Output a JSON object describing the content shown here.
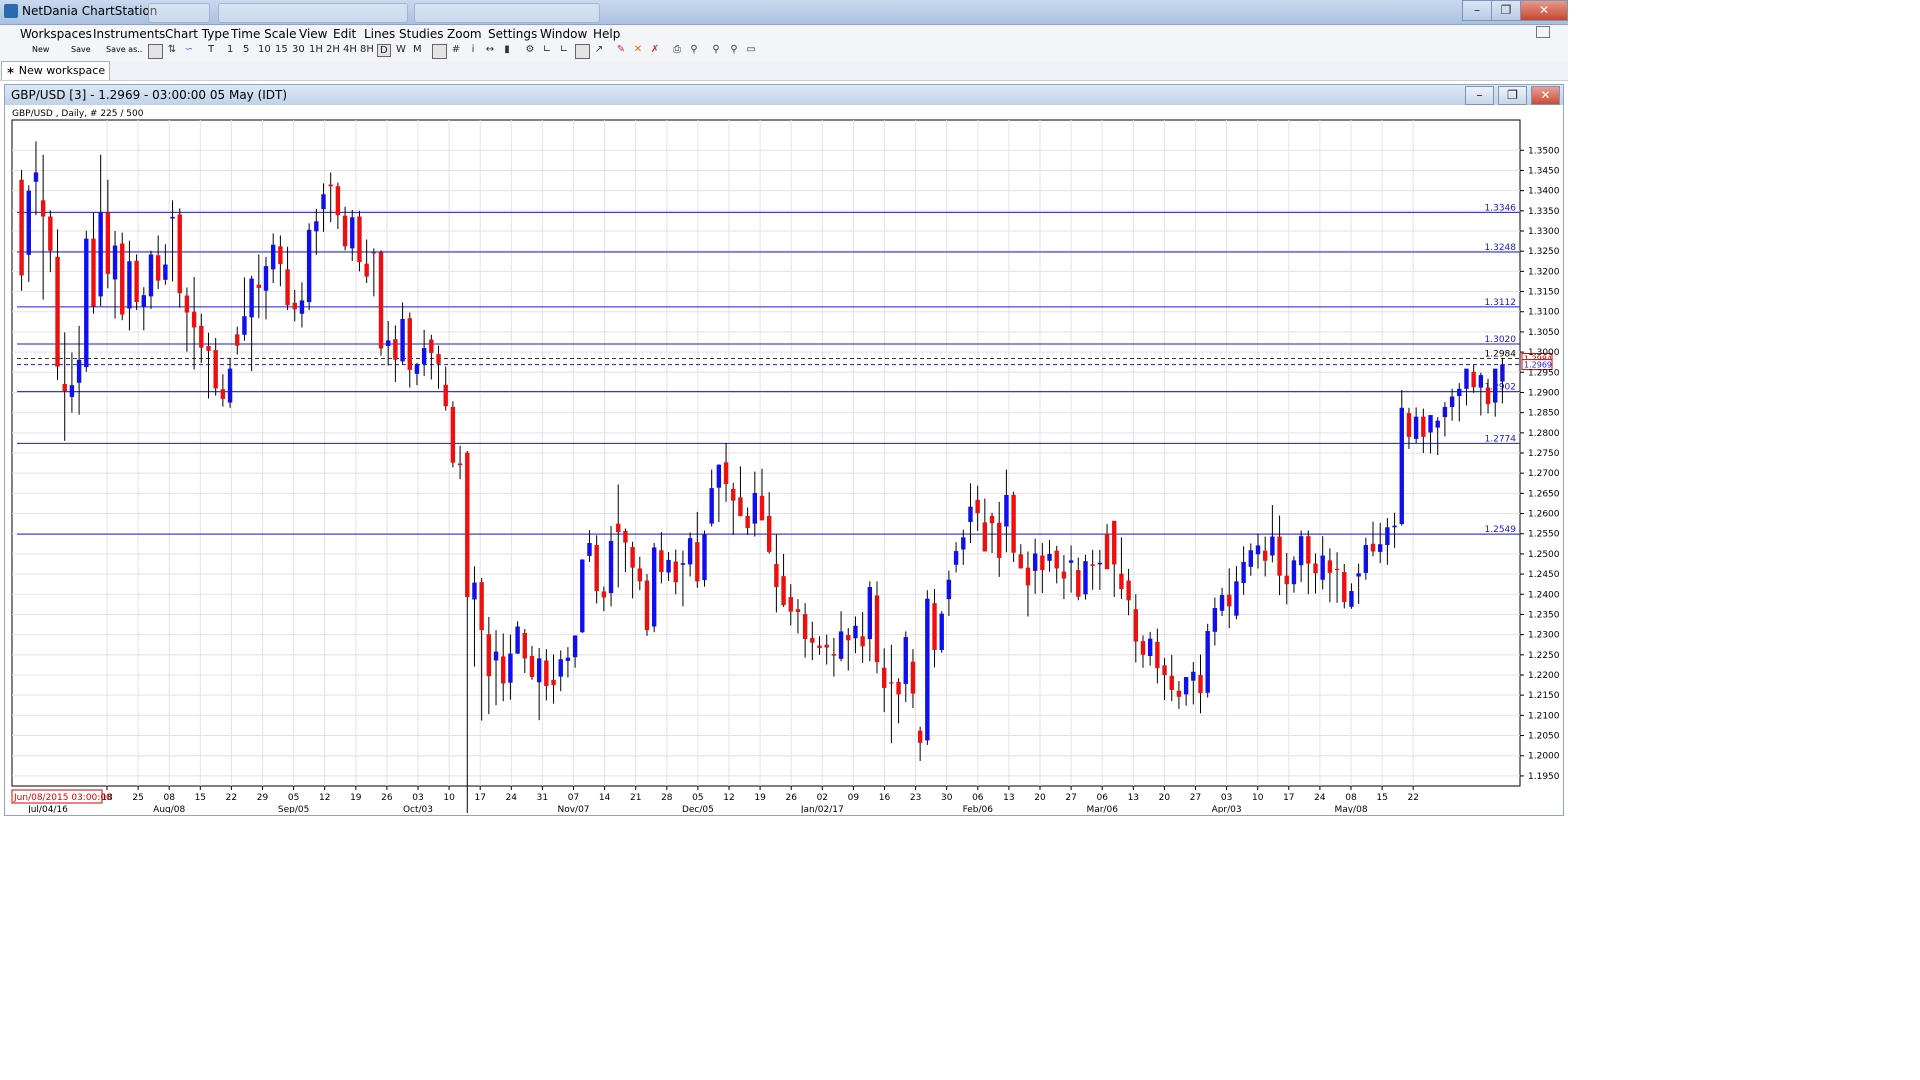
{
  "app": {
    "title": "NetDania ChartStation"
  },
  "menu": [
    "Workspaces",
    "Instruments",
    "Chart Type",
    "Time Scale",
    "View",
    "Edit",
    "Lines",
    "Studies",
    "Zoom",
    "Settings",
    "Window",
    "Help"
  ],
  "toolbar": {
    "new_label": "New",
    "save_label": "Save",
    "saveas_label": "Save as..",
    "timescales": [
      "T",
      "1",
      "5",
      "10",
      "15",
      "30",
      "1H",
      "2H",
      "4H",
      "8H",
      "D",
      "W",
      "M"
    ],
    "selected_timescale": "D"
  },
  "workspace_tab": "New workspace",
  "chart_window": {
    "title": "GBP/USD [3] - 1.2969 - 03:00:00  05 May (IDT)"
  },
  "chart_data": {
    "type": "candlestick",
    "instrument_label": "GBP/USD , Daily, # 225 / 500",
    "ylim": [
      1.1925,
      1.3575
    ],
    "y_ticks": [
      "1.3500",
      "1.3450",
      "1.3400",
      "1.3350",
      "1.3300",
      "1.3250",
      "1.3200",
      "1.3150",
      "1.3100",
      "1.3050",
      "1.3000",
      "1.2950",
      "1.2900",
      "1.2850",
      "1.2800",
      "1.2750",
      "1.2700",
      "1.2650",
      "1.2600",
      "1.2550",
      "1.2500",
      "1.2450",
      "1.2400",
      "1.2350",
      "1.2300",
      "1.2250",
      "1.2200",
      "1.2150",
      "1.2100",
      "1.2050",
      "1.2000",
      "1.1950"
    ],
    "horizontal_lines": [
      {
        "value": 1.3346,
        "label": "1.3346"
      },
      {
        "value": 1.3248,
        "label": "1.3248"
      },
      {
        "value": 1.3112,
        "label": "1.3112"
      },
      {
        "value": 1.302,
        "label": "1.3020"
      },
      {
        "value": 1.2902,
        "label": "1.2902"
      },
      {
        "value": 1.2774,
        "label": "1.2774"
      },
      {
        "value": 1.2549,
        "label": "1.2549"
      }
    ],
    "dashed_lines": [
      {
        "value": 1.2984,
        "label": "1.2984"
      },
      {
        "value": 1.2969,
        "label": "1.2969"
      }
    ],
    "first_date_label": "Jun/08/2015 03:00:00",
    "x_day_labels": [
      "18",
      "25",
      "08",
      "15",
      "22",
      "29",
      "05",
      "12",
      "19",
      "26",
      "03",
      "10",
      "17",
      "24",
      "31",
      "07",
      "14",
      "21",
      "28",
      "05",
      "12",
      "19",
      "26",
      "02",
      "09",
      "16",
      "23",
      "30",
      "06",
      "13",
      "20",
      "27",
      "06",
      "13",
      "20",
      "27",
      "03",
      "10",
      "17",
      "24",
      "08",
      "15",
      "22"
    ],
    "x_month_labels": [
      "Jul/04/16",
      "Aug/08",
      "Sep/05",
      "Oct/03",
      "Nov/07",
      "Dec/05",
      "Jan/02/17",
      "Feb/06",
      "Mar/06",
      "Apr/03",
      "May/08"
    ],
    "candles": [
      [
        1.3427,
        1.3451,
        1.3152,
        1.319
      ],
      [
        1.3241,
        1.3413,
        1.3174,
        1.34
      ],
      [
        1.3422,
        1.3522,
        1.3339,
        1.3445
      ],
      [
        1.3376,
        1.3489,
        1.313,
        1.3336
      ],
      [
        1.3336,
        1.3351,
        1.3198,
        1.3251
      ],
      [
        1.3236,
        1.3304,
        1.2931,
        1.2964
      ],
      [
        1.2921,
        1.3049,
        1.278,
        1.2903
      ],
      [
        1.2889,
        1.2999,
        1.285,
        1.2918
      ],
      [
        1.2924,
        1.3065,
        1.2845,
        1.2981
      ],
      [
        1.2963,
        1.3301,
        1.2951,
        1.3281
      ],
      [
        1.3281,
        1.3345,
        1.3095,
        1.3113
      ],
      [
        1.3138,
        1.3489,
        1.3114,
        1.3346
      ],
      [
        1.3346,
        1.3427,
        1.3158,
        1.3194
      ],
      [
        1.318,
        1.33,
        1.3083,
        1.3264
      ],
      [
        1.3269,
        1.3296,
        1.3079,
        1.3093
      ],
      [
        1.3108,
        1.3276,
        1.3054,
        1.3225
      ],
      [
        1.3226,
        1.3242,
        1.3104,
        1.3124
      ],
      [
        1.3112,
        1.3161,
        1.3054,
        1.3141
      ],
      [
        1.3138,
        1.3251,
        1.3107,
        1.3242
      ],
      [
        1.324,
        1.3289,
        1.3156,
        1.3177
      ],
      [
        1.3179,
        1.3267,
        1.3167,
        1.3217
      ],
      [
        1.3331,
        1.3376,
        1.3175,
        1.3335
      ],
      [
        1.3341,
        1.3356,
        1.311,
        1.3146
      ],
      [
        1.314,
        1.316,
        1.3001,
        1.3098
      ],
      [
        1.31,
        1.3186,
        1.2957,
        1.3061
      ],
      [
        1.3065,
        1.3095,
        1.2973,
        1.3011
      ],
      [
        1.3015,
        1.3048,
        1.2885,
        1.3003
      ],
      [
        1.3005,
        1.3035,
        1.2892,
        1.291
      ],
      [
        1.2908,
        1.2945,
        1.2865,
        1.2884
      ],
      [
        1.2875,
        1.2986,
        1.2862,
        1.2959
      ],
      [
        1.3044,
        1.3063,
        1.2994,
        1.3016
      ],
      [
        1.3043,
        1.3185,
        1.3028,
        1.3089
      ],
      [
        1.3086,
        1.3189,
        1.2953,
        1.3182
      ],
      [
        1.3167,
        1.3242,
        1.3084,
        1.3159
      ],
      [
        1.3152,
        1.3236,
        1.3081,
        1.3213
      ],
      [
        1.3205,
        1.3294,
        1.3171,
        1.3266
      ],
      [
        1.3262,
        1.3289,
        1.3163,
        1.3218
      ],
      [
        1.3205,
        1.3261,
        1.3104,
        1.3116
      ],
      [
        1.3122,
        1.3154,
        1.3076,
        1.3106
      ],
      [
        1.3095,
        1.3173,
        1.3061,
        1.3128
      ],
      [
        1.3124,
        1.3319,
        1.3104,
        1.3303
      ],
      [
        1.3299,
        1.3355,
        1.3241,
        1.3324
      ],
      [
        1.3354,
        1.3418,
        1.3298,
        1.3391
      ],
      [
        1.3415,
        1.3445,
        1.3322,
        1.3411
      ],
      [
        1.3411,
        1.342,
        1.3305,
        1.3339
      ],
      [
        1.3338,
        1.336,
        1.3252,
        1.3262
      ],
      [
        1.3257,
        1.3352,
        1.3226,
        1.3334
      ],
      [
        1.3336,
        1.335,
        1.32,
        1.3223
      ],
      [
        1.3219,
        1.3279,
        1.3171,
        1.3187
      ],
      [
        1.3247,
        1.3257,
        1.3138,
        1.3246
      ],
      [
        1.3247,
        1.3252,
        1.2991,
        1.3009
      ],
      [
        1.3015,
        1.3077,
        1.2967,
        1.3029
      ],
      [
        1.3032,
        1.3066,
        1.2926,
        1.2981
      ],
      [
        1.2977,
        1.3123,
        1.2969,
        1.3082
      ],
      [
        1.3084,
        1.3098,
        1.2912,
        1.2956
      ],
      [
        1.2946,
        1.2973,
        1.2918,
        1.297
      ],
      [
        1.297,
        1.3055,
        1.2941,
        1.301
      ],
      [
        1.3031,
        1.3043,
        1.2932,
        1.2998
      ],
      [
        1.2995,
        1.3016,
        1.2909,
        1.2971
      ],
      [
        1.2919,
        1.2964,
        1.2855,
        1.2866
      ],
      [
        1.2864,
        1.2878,
        1.2714,
        1.2726
      ],
      [
        1.2724,
        1.2768,
        1.2685,
        1.272
      ],
      [
        1.2751,
        1.2755,
        1.1491,
        1.2393
      ],
      [
        1.2387,
        1.2469,
        1.2221,
        1.2429
      ],
      [
        1.243,
        1.244,
        1.2087,
        1.2311
      ],
      [
        1.2301,
        1.2344,
        1.2103,
        1.2197
      ],
      [
        1.2236,
        1.2311,
        1.2125,
        1.2258
      ],
      [
        1.2246,
        1.2303,
        1.2135,
        1.2179
      ],
      [
        1.2181,
        1.23,
        1.2139,
        1.2253
      ],
      [
        1.2253,
        1.2333,
        1.2252,
        1.232
      ],
      [
        1.2304,
        1.2314,
        1.2205,
        1.2241
      ],
      [
        1.2247,
        1.2272,
        1.2188,
        1.2195
      ],
      [
        1.2182,
        1.2267,
        1.2088,
        1.2241
      ],
      [
        1.2236,
        1.2264,
        1.2137,
        1.2173
      ],
      [
        1.2188,
        1.2251,
        1.2129,
        1.2175
      ],
      [
        1.2196,
        1.2261,
        1.216,
        1.2239
      ],
      [
        1.2235,
        1.2269,
        1.2194,
        1.2243
      ],
      [
        1.2244,
        1.2294,
        1.2218,
        1.2298
      ],
      [
        1.2306,
        1.2487,
        1.2304,
        1.2486
      ],
      [
        1.2495,
        1.2559,
        1.248,
        1.2527
      ],
      [
        1.2522,
        1.2546,
        1.2377,
        1.2408
      ],
      [
        1.2407,
        1.2419,
        1.2358,
        1.2392
      ],
      [
        1.2403,
        1.2569,
        1.237,
        1.2532
      ],
      [
        1.2575,
        1.2672,
        1.2417,
        1.2554
      ],
      [
        1.2557,
        1.2563,
        1.2455,
        1.2528
      ],
      [
        1.2517,
        1.253,
        1.239,
        1.2466
      ],
      [
        1.2464,
        1.2493,
        1.241,
        1.2432
      ],
      [
        1.2434,
        1.245,
        1.2297,
        1.2311
      ],
      [
        1.232,
        1.2527,
        1.2306,
        1.2516
      ],
      [
        1.2509,
        1.2554,
        1.2427,
        1.2455
      ],
      [
        1.2454,
        1.2505,
        1.2433,
        1.2485
      ],
      [
        1.2481,
        1.2511,
        1.24,
        1.243
      ],
      [
        1.2473,
        1.2508,
        1.237,
        1.2477
      ],
      [
        1.2474,
        1.2553,
        1.2444,
        1.2539
      ],
      [
        1.2529,
        1.2604,
        1.2416,
        1.2432
      ],
      [
        1.2435,
        1.2558,
        1.2419,
        1.2548
      ],
      [
        1.2575,
        1.2709,
        1.2568,
        1.2663
      ],
      [
        1.2664,
        1.2722,
        1.2579,
        1.2721
      ],
      [
        1.2727,
        1.2775,
        1.2629,
        1.2673
      ],
      [
        1.2661,
        1.2676,
        1.2547,
        1.2632
      ],
      [
        1.264,
        1.2717,
        1.2593,
        1.2594
      ],
      [
        1.2594,
        1.2615,
        1.2547,
        1.2564
      ],
      [
        1.2575,
        1.2704,
        1.2543,
        1.2651
      ],
      [
        1.2644,
        1.2711,
        1.2584,
        1.2583
      ],
      [
        1.2594,
        1.2653,
        1.2501,
        1.2505
      ],
      [
        1.2475,
        1.2548,
        1.2355,
        1.2418
      ],
      [
        1.2445,
        1.25,
        1.2369,
        1.2373
      ],
      [
        1.2393,
        1.2425,
        1.2323,
        1.2357
      ],
      [
        1.2363,
        1.2388,
        1.2303,
        1.2356
      ],
      [
        1.2351,
        1.2378,
        1.2243,
        1.2289
      ],
      [
        1.2292,
        1.2332,
        1.2237,
        1.228
      ],
      [
        1.2273,
        1.2296,
        1.225,
        1.2267
      ],
      [
        1.2275,
        1.23,
        1.2226,
        1.2268
      ],
      [
        1.2252,
        1.2292,
        1.2196,
        1.2248
      ],
      [
        1.224,
        1.2358,
        1.2234,
        1.2308
      ],
      [
        1.2299,
        1.2316,
        1.2211,
        1.2286
      ],
      [
        1.2291,
        1.2345,
        1.2254,
        1.2322
      ],
      [
        1.2296,
        1.2356,
        1.223,
        1.2271
      ],
      [
        1.2289,
        1.2432,
        1.2234,
        1.2418
      ],
      [
        1.2397,
        1.2432,
        1.2204,
        1.2232
      ],
      [
        1.2218,
        1.2266,
        1.2108,
        1.2168
      ],
      [
        1.2182,
        1.2275,
        1.2031,
        1.2179
      ],
      [
        1.2183,
        1.2192,
        1.208,
        1.2152
      ],
      [
        1.2178,
        1.2308,
        1.2133,
        1.2294
      ],
      [
        1.2233,
        1.2264,
        1.2118,
        1.2154
      ],
      [
        1.2062,
        1.2072,
        1.1987,
        1.2032
      ],
      [
        1.2038,
        1.241,
        1.2027,
        1.2389
      ],
      [
        1.2378,
        1.2413,
        1.2219,
        1.2262
      ],
      [
        1.2262,
        1.2358,
        1.2255,
        1.2352
      ],
      [
        1.2388,
        1.2459,
        1.2346,
        1.2436
      ],
      [
        1.2473,
        1.2529,
        1.2454,
        1.2507
      ],
      [
        1.2511,
        1.256,
        1.2473,
        1.2541
      ],
      [
        1.2579,
        1.2675,
        1.2527,
        1.2617
      ],
      [
        1.2634,
        1.2669,
        1.2557,
        1.2601
      ],
      [
        1.2578,
        1.2637,
        1.2513,
        1.2506
      ],
      [
        1.2594,
        1.2602,
        1.2502,
        1.2576
      ],
      [
        1.2577,
        1.2629,
        1.2443,
        1.249
      ],
      [
        1.2568,
        1.2709,
        1.2504,
        1.2646
      ],
      [
        1.2646,
        1.2654,
        1.248,
        1.2503
      ],
      [
        1.2499,
        1.2524,
        1.2464,
        1.2464
      ],
      [
        1.2466,
        1.2506,
        1.2345,
        1.2422
      ],
      [
        1.2458,
        1.2538,
        1.2401,
        1.2501
      ],
      [
        1.2496,
        1.2527,
        1.2403,
        1.246
      ],
      [
        1.2483,
        1.2535,
        1.2456,
        1.25
      ],
      [
        1.2508,
        1.252,
        1.2427,
        1.2464
      ],
      [
        1.2456,
        1.2497,
        1.2388,
        1.2439
      ],
      [
        1.2478,
        1.2521,
        1.2404,
        1.2484
      ],
      [
        1.246,
        1.2491,
        1.2385,
        1.2394
      ],
      [
        1.24,
        1.2498,
        1.2387,
        1.2482
      ],
      [
        1.2474,
        1.251,
        1.2411,
        1.247
      ],
      [
        1.2474,
        1.251,
        1.2411,
        1.2478
      ],
      [
        1.255,
        1.2574,
        1.247,
        1.2462
      ],
      [
        1.2582,
        1.2574,
        1.2393,
        1.2474
      ],
      [
        1.2451,
        1.2541,
        1.2388,
        1.2413
      ],
      [
        1.2434,
        1.2463,
        1.2348,
        1.2385
      ],
      [
        1.2363,
        1.24,
        1.2231,
        1.2283
      ],
      [
        1.2284,
        1.2298,
        1.2218,
        1.225
      ],
      [
        1.2247,
        1.2307,
        1.2223,
        1.229
      ],
      [
        1.2282,
        1.2315,
        1.2179,
        1.2217
      ],
      [
        1.2224,
        1.2242,
        1.2138,
        1.22
      ],
      [
        1.2198,
        1.225,
        1.2135,
        1.2163
      ],
      [
        1.2161,
        1.2185,
        1.2116,
        1.2146
      ],
      [
        1.2152,
        1.2185,
        1.2124,
        1.2195
      ],
      [
        1.2186,
        1.2232,
        1.2127,
        1.2208
      ],
      [
        1.22,
        1.2251,
        1.2105,
        1.2155
      ],
      [
        1.2156,
        1.2327,
        1.2144,
        1.2309
      ],
      [
        1.2307,
        1.2392,
        1.2273,
        1.2366
      ],
      [
        1.2359,
        1.2416,
        1.2346,
        1.2398
      ],
      [
        1.2399,
        1.2464,
        1.2316,
        1.237
      ],
      [
        1.2347,
        1.247,
        1.2338,
        1.2432
      ],
      [
        1.2428,
        1.2519,
        1.2399,
        1.248
      ],
      [
        1.2468,
        1.2526,
        1.2446,
        1.2509
      ],
      [
        1.2499,
        1.255,
        1.2464,
        1.2521
      ],
      [
        1.2508,
        1.2543,
        1.2444,
        1.2483
      ],
      [
        1.2496,
        1.2621,
        1.2479,
        1.2543
      ],
      [
        1.2543,
        1.2595,
        1.2398,
        1.2446
      ],
      [
        1.2446,
        1.2502,
        1.2375,
        1.2425
      ],
      [
        1.2425,
        1.2494,
        1.2404,
        1.2484
      ],
      [
        1.2472,
        1.2558,
        1.243,
        1.2544
      ],
      [
        1.2544,
        1.2558,
        1.24,
        1.2476
      ],
      [
        1.2476,
        1.2501,
        1.2402,
        1.2452
      ],
      [
        1.2436,
        1.2544,
        1.2412,
        1.2496
      ],
      [
        1.2484,
        1.2514,
        1.238,
        1.2453
      ],
      [
        1.2463,
        1.2504,
        1.2379,
        1.246
      ],
      [
        1.2455,
        1.2475,
        1.2365,
        1.2381
      ],
      [
        1.2369,
        1.2427,
        1.2364,
        1.2408
      ],
      [
        1.2444,
        1.2476,
        1.2376,
        1.2452
      ],
      [
        1.2453,
        1.254,
        1.2436,
        1.2522
      ],
      [
        1.2525,
        1.258,
        1.2494,
        1.2506
      ],
      [
        1.2505,
        1.2577,
        1.2477,
        1.2524
      ],
      [
        1.2522,
        1.2589,
        1.2473,
        1.2566
      ],
      [
        1.2566,
        1.2602,
        1.2515,
        1.257
      ],
      [
        1.2574,
        1.2906,
        1.257,
        1.2862
      ],
      [
        1.2849,
        1.2862,
        1.276,
        1.279
      ],
      [
        1.2785,
        1.2863,
        1.2774,
        1.284
      ],
      [
        1.284,
        1.286,
        1.275,
        1.279
      ],
      [
        1.2801,
        1.2839,
        1.2749,
        1.2844
      ],
      [
        1.2813,
        1.2839,
        1.2745,
        1.283
      ],
      [
        1.2839,
        1.2876,
        1.2791,
        1.2864
      ],
      [
        1.2864,
        1.2909,
        1.283,
        1.289
      ],
      [
        1.2891,
        1.2923,
        1.2828,
        1.2909
      ],
      [
        1.2909,
        1.295,
        1.2868,
        1.2959
      ],
      [
        1.2951,
        1.2968,
        1.2899,
        1.2913
      ],
      [
        1.2912,
        1.2949,
        1.2843,
        1.2943
      ],
      [
        1.2912,
        1.2934,
        1.2848,
        1.2871
      ],
      [
        1.2875,
        1.2952,
        1.284,
        1.2959
      ],
      [
        1.2927,
        1.2986,
        1.2873,
        1.2969
      ]
    ]
  }
}
